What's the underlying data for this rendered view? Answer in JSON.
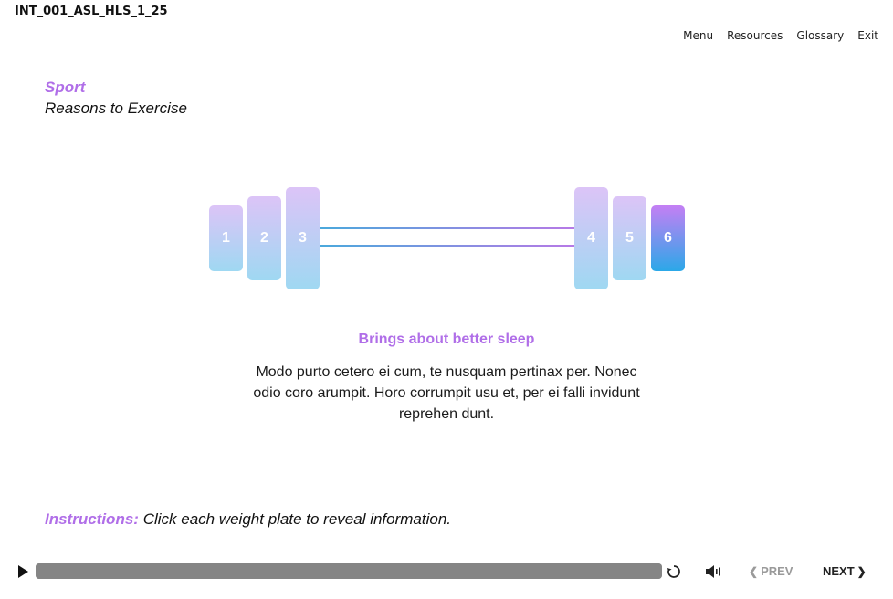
{
  "header": {
    "course_id": "INT_001_ASL_HLS_1_25"
  },
  "nav": {
    "menu": "Menu",
    "resources": "Resources",
    "glossary": "Glossary",
    "exit": "Exit"
  },
  "page": {
    "title": "Sport",
    "subtitle": "Reasons to Exercise"
  },
  "plates": [
    {
      "label": "1",
      "active": false
    },
    {
      "label": "2",
      "active": false
    },
    {
      "label": "3",
      "active": false
    },
    {
      "label": "4",
      "active": false
    },
    {
      "label": "5",
      "active": false
    },
    {
      "label": "6",
      "active": true
    }
  ],
  "content": {
    "heading": "Brings about better sleep",
    "body": "Modo purto cetero ei cum, te nusquam pertinax per. Nonec odio coro arumpit. Horo corrumpit usu et, per ei falli invidunt reprehen dunt."
  },
  "instructions": {
    "label": "Instructions:",
    "text": "Click each weight plate to reveal information."
  },
  "player": {
    "progress": 1.0,
    "prev_label": "PREV",
    "next_label": "NEXT",
    "prev_enabled": false
  },
  "colors": {
    "accent": "#b06ee8",
    "plate_top": "#dcc4f7",
    "plate_bottom": "#9fd8f2",
    "plate_active_top": "#c47ff4",
    "plate_active_bottom": "#2ba8e8",
    "progress": "#858585"
  },
  "icons": [
    "play-icon",
    "replay-icon",
    "volume-icon",
    "chevron-left-icon",
    "chevron-right-icon"
  ]
}
